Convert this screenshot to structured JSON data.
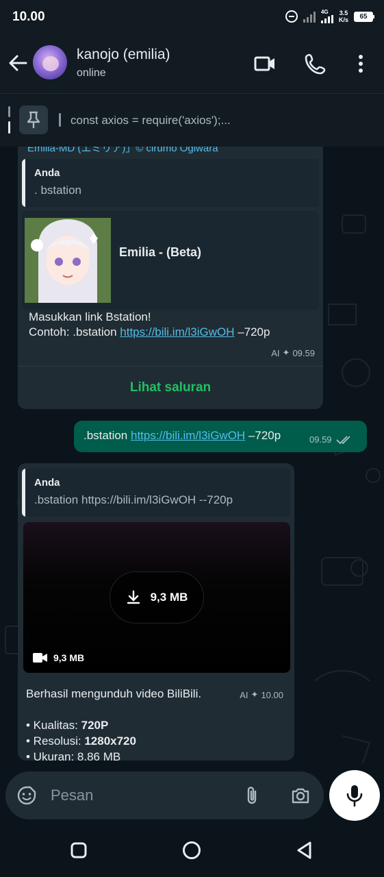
{
  "status_bar": {
    "time": "10.00",
    "network": "4G",
    "speed_top": "3.5",
    "speed_unit": "K/s",
    "battery": "65"
  },
  "header": {
    "contact_name": "kanojo (emilia)",
    "status": "online"
  },
  "pinned": {
    "text": "const axios = require('axios');..."
  },
  "messages": {
    "clipped_top_text": "Emilia-MD (エミリア)」© cirumo Ogiwara",
    "channel_msg": {
      "quote_name": "Anda",
      "quote_text": ". bstation",
      "card_title": "Emilia - (Beta)",
      "line1": "Masukkan link Bstation!",
      "line2_prefix": "Contoh: .bstation ",
      "line2_link": "https://bili.im/l3iGwOH",
      "line2_suffix": " –720p",
      "ai_label": "AI",
      "time": "09.59",
      "action": "Lihat saluran"
    },
    "outgoing": {
      "prefix": ".bstation ",
      "link": "https://bili.im/l3iGwOH",
      "suffix": " –720p",
      "time": "09.59"
    },
    "video_msg": {
      "quote_name": "Anda",
      "quote_text": ".bstation https://bili.im/l3iGwOH --720p",
      "download_size": "9,3 MB",
      "video_size": "9,3 MB",
      "caption": "Berhasil mengunduh video BiliBili.",
      "ai_label": "AI",
      "time": "10.00",
      "quality_label": "• Kualitas: ",
      "quality_value": "720P",
      "resolution_label": "• Resolusi: ",
      "resolution_value": "1280x720",
      "size_line": "• Ukuran: 8.86 MB"
    }
  },
  "input": {
    "placeholder": "Pesan"
  },
  "colors": {
    "header_bg": "#111b21",
    "chat_bg": "#0b141a",
    "incoming_bubble": "#202c33",
    "outgoing_bubble": "#005c4b",
    "link": "#53bdeb",
    "action_green": "#21c063"
  }
}
